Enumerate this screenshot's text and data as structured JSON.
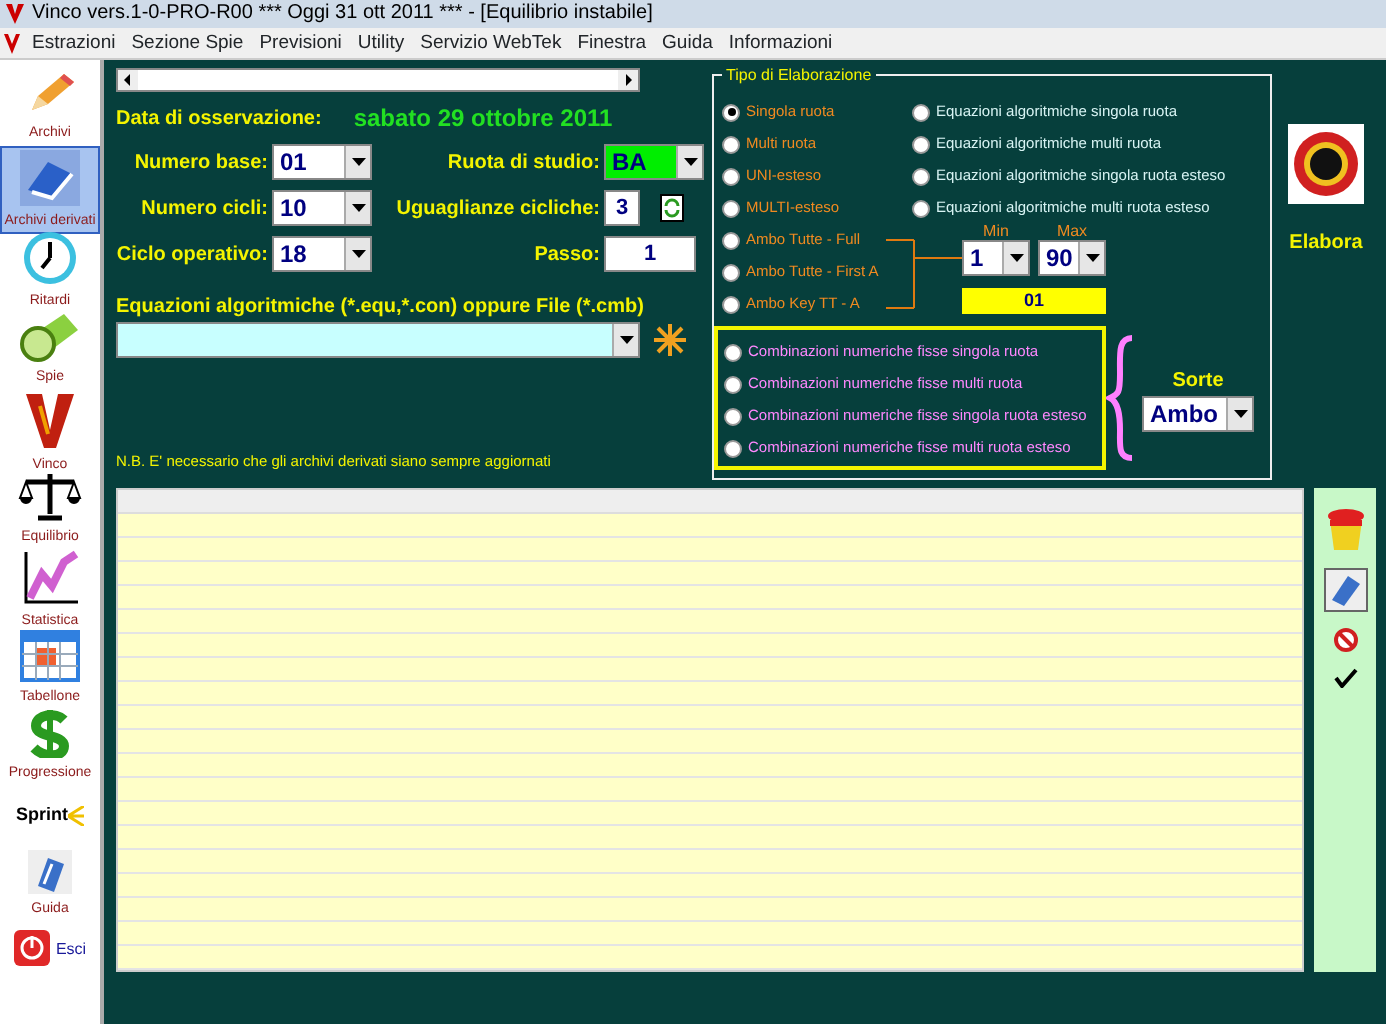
{
  "window": {
    "title": "Vinco vers.1-0-PRO-R00  ***  Oggi 31 ott 2011  ***   - [Equilibrio instabile]"
  },
  "menu": [
    "Estrazioni",
    "Sezione Spie",
    "Previsioni",
    "Utility",
    "Servizio WebTek",
    "Finestra",
    "Guida",
    "Informazioni"
  ],
  "sidebar": {
    "items": [
      {
        "label": "Archivi",
        "kind": "pencil",
        "selected": false
      },
      {
        "label": "Archivi derivati",
        "kind": "book",
        "selected": true
      },
      {
        "label": "Ritardi",
        "kind": "clock",
        "selected": false
      },
      {
        "label": "Spie",
        "kind": "flashlight",
        "selected": false
      },
      {
        "label": "Vinco",
        "kind": "vinco",
        "selected": false
      },
      {
        "label": "Equilibrio",
        "kind": "scales",
        "selected": false
      },
      {
        "label": "Statistica",
        "kind": "chart",
        "selected": false
      },
      {
        "label": "Tabellone",
        "kind": "table",
        "selected": false
      },
      {
        "label": "Progressione",
        "kind": "dollar",
        "selected": false
      },
      {
        "label": "Sprint",
        "kind": "sprint",
        "selected": false
      },
      {
        "label": "Guida",
        "kind": "guide",
        "selected": false
      },
      {
        "label": "Esci",
        "kind": "exit",
        "selected": false
      }
    ]
  },
  "form": {
    "date_label": "Data di osservazione:",
    "date_value": "sabato 29 ottobre 2011",
    "numero_base": {
      "label": "Numero base:",
      "value": "01"
    },
    "ruota": {
      "label": "Ruota di studio:",
      "value": "BA"
    },
    "numero_cicli": {
      "label": "Numero cicli:",
      "value": "10"
    },
    "uguaglianze": {
      "label": "Uguaglianze cicliche:",
      "value": "3"
    },
    "ciclo": {
      "label": "Ciclo operativo:",
      "value": "18"
    },
    "passo": {
      "label": "Passo:",
      "value": "1"
    },
    "equazioni": {
      "label": "Equazioni algoritmiche (*.equ,*.con) oppure File (*.cmb)"
    },
    "note": "N.B. E' necessario che gli archivi derivati siano sempre aggiornati"
  },
  "tipo": {
    "legend": "Tipo di Elaborazione",
    "options": [
      {
        "label": "Singola ruota",
        "selected": true
      },
      {
        "label": "Multi ruota",
        "selected": false
      },
      {
        "label": "UNI-esteso",
        "selected": false
      },
      {
        "label": "MULTI-esteso",
        "selected": false
      }
    ],
    "equation_options": [
      {
        "label": "Equazioni algoritmiche singola ruota",
        "selected": false
      },
      {
        "label": "Equazioni algoritmiche multi ruota",
        "selected": false
      },
      {
        "label": "Equazioni algoritmiche singola ruota esteso",
        "selected": false
      },
      {
        "label": "Equazioni algoritmiche multi ruota esteso",
        "selected": false
      }
    ],
    "ambo_options": [
      {
        "label": "Ambo Tutte - Full",
        "selected": false
      },
      {
        "label": "Ambo Tutte - First A",
        "selected": false
      },
      {
        "label": "Ambo Key TT -  A",
        "selected": false
      }
    ],
    "min": {
      "label": "Min",
      "value": "1"
    },
    "max": {
      "label": "Max",
      "value": "90"
    },
    "key_value": "01",
    "combination_options": [
      {
        "label": "Combinazioni numeriche fisse singola ruota",
        "selected": false
      },
      {
        "label": "Combinazioni numeriche fisse multi ruota",
        "selected": false
      },
      {
        "label": "Combinazioni numeriche fisse singola ruota esteso",
        "selected": false
      },
      {
        "label": "Combinazioni numeriche fisse multi ruota esteso",
        "selected": false
      }
    ],
    "sorte": {
      "label": "Sorte",
      "value": "Ambo"
    }
  },
  "elabora": {
    "label": "Elabora"
  }
}
